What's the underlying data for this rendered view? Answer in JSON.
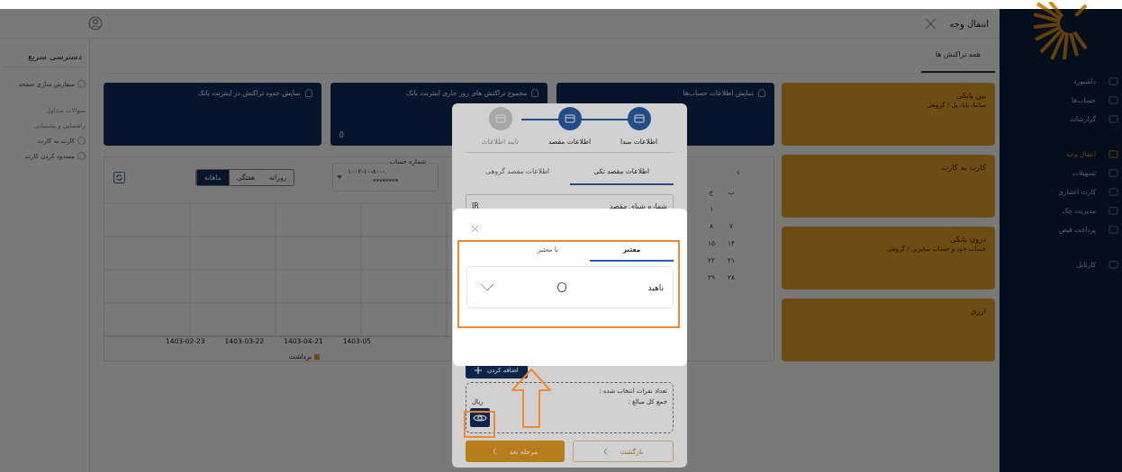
{
  "header": {
    "title": "انتقال وجه"
  },
  "sidebar": {
    "groups": [
      {
        "items": [
          {
            "label": "داشبورد",
            "selected": false
          },
          {
            "label": "حساب‌ها",
            "selected": false
          },
          {
            "label": "گزارشات",
            "selected": false
          }
        ]
      },
      {
        "items": [
          {
            "label": "انتقال وجه",
            "selected": true
          },
          {
            "label": "تسهیلات",
            "selected": false
          },
          {
            "label": "کارت اعتباری",
            "selected": false
          },
          {
            "label": "مدیریت چک",
            "selected": false
          },
          {
            "label": "پرداخت قبض",
            "selected": false
          }
        ]
      },
      {
        "items": [
          {
            "label": "کارتابل",
            "selected": false
          }
        ]
      }
    ]
  },
  "quick_access": {
    "title": "دسترسی سریع",
    "items": [
      {
        "label": "سفارش سازی صفحه",
        "disabled": false
      },
      {
        "label": "سوالات متداول",
        "disabled": true
      },
      {
        "label": "راهنمایی و پشتیبانی",
        "disabled": true
      },
      {
        "label": "کارت به کارت",
        "disabled": false
      },
      {
        "label": "مسدود کردن کارت",
        "disabled": false
      }
    ]
  },
  "tabs": [
    {
      "label": "همه تراکنش ها",
      "selected": true
    }
  ],
  "info_cards": [
    {
      "title": "نمایش اطلاعات حساب‌ها"
    },
    {
      "title": "مجموع تراکنش های روز جاری اینترنت بانک",
      "value": "0"
    },
    {
      "title": "نمایش حدود تراکنش در اینترنت بانک"
    }
  ],
  "transfer_types": [
    {
      "title": "بین بانکی",
      "subtitle": "ساتنا، پایا، پل / گروهی"
    },
    {
      "title": "کارت به کارت"
    },
    {
      "title": "درون بانکی",
      "subtitle": "حساب خود و حساب سایرین / گروهی"
    },
    {
      "title": "ارزی"
    }
  ],
  "chart_panel": {
    "periods": [
      {
        "label": "روزانه",
        "selected": false
      },
      {
        "label": "هفتگی",
        "selected": false
      },
      {
        "label": "ماهانه",
        "selected": true
      }
    ],
    "account": {
      "label": "شماره حساب",
      "value": "۱۰۰۲-۱۰-۸۰۰-.",
      "masked": "********"
    },
    "x_labels": [
      "1403-05",
      "1403-04-21",
      "1403-03-22",
      "1403-02-23"
    ],
    "legend": "برداشت"
  },
  "calendar": {
    "nav": "›",
    "weekdays": [
      "پ",
      "ج"
    ],
    "weeks": [
      [
        "۱"
      ],
      [
        "۷",
        "۸"
      ],
      [
        "۱۴",
        "۱۵"
      ],
      [
        "۲۱",
        "۲۲"
      ],
      [
        "۲۸",
        "۲۹"
      ]
    ]
  },
  "transfer_modal": {
    "steps": [
      {
        "label": "اطلاعات مبدا",
        "active": true
      },
      {
        "label": "اطلاعات مقصد",
        "active": true
      },
      {
        "label": "تایید اطلاعات",
        "active": false
      }
    ],
    "tabs": [
      {
        "label": "اطلاعات مقصد تکی",
        "selected": true
      },
      {
        "label": "اطلاعات مقصد گروهی",
        "selected": false
      }
    ],
    "field": {
      "label": "شماره شبای مقصد",
      "value": "IR"
    },
    "add_button": "اضافه کردن",
    "summary": {
      "count_label": "تعداد نفرات انتخاب شده :",
      "total_label": "جمع کل مبالغ :",
      "currency": "ریال"
    },
    "next_button": "مرحله بعد",
    "back_button": "بازگشت"
  },
  "contacts_dialog": {
    "tabs": [
      {
        "label": "معتبر",
        "selected": true
      },
      {
        "label": "نا معتبر",
        "selected": false
      }
    ],
    "contacts": [
      {
        "name": "ناهید",
        "expanded": false
      }
    ]
  }
}
